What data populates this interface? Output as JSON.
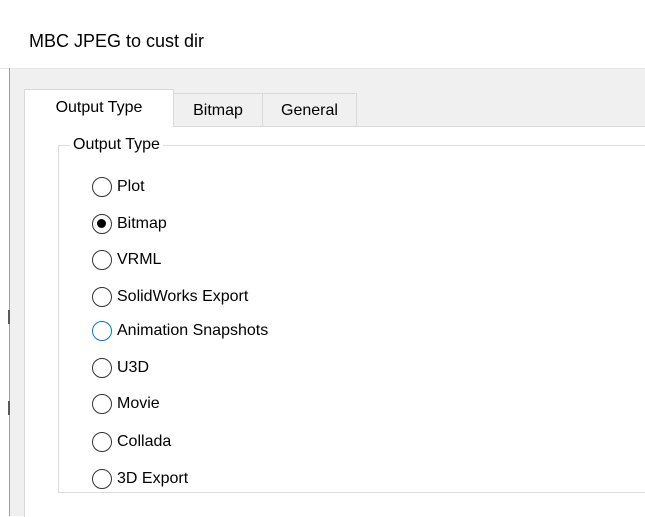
{
  "window": {
    "title": "MBC JPEG to cust dir"
  },
  "tabs": [
    {
      "label": "Output Type",
      "selected": true
    },
    {
      "label": "Bitmap",
      "selected": false
    },
    {
      "label": "General",
      "selected": false
    }
  ],
  "output_type_group": {
    "legend": "Output Type",
    "options": [
      {
        "label": "Plot",
        "checked": false,
        "focused": false
      },
      {
        "label": "Bitmap",
        "checked": true,
        "focused": false
      },
      {
        "label": "VRML",
        "checked": false,
        "focused": false
      },
      {
        "label": "SolidWorks Export",
        "checked": false,
        "focused": false
      },
      {
        "label": "Animation Snapshots",
        "checked": false,
        "focused": true
      },
      {
        "label": "U3D",
        "checked": false,
        "focused": false
      },
      {
        "label": "Movie",
        "checked": false,
        "focused": false
      },
      {
        "label": "Collada",
        "checked": false,
        "focused": false
      },
      {
        "label": "3D Export",
        "checked": false,
        "focused": false
      }
    ]
  },
  "colors": {
    "focus_ring": "#0078d7",
    "tab_strip_background": "#f0f0f0",
    "panel_background": "#ffffff"
  }
}
